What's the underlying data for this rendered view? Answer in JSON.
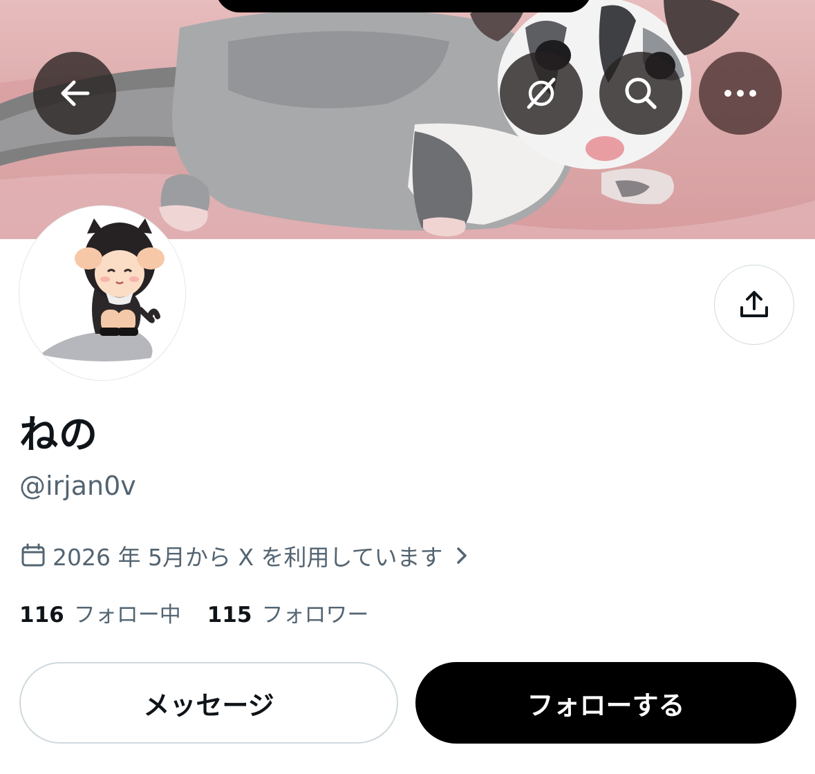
{
  "header": {
    "back_icon": "arrow-left-icon",
    "grok_icon": "grok-icon",
    "search_icon": "search-icon",
    "more_icon": "more-horizontal-icon",
    "banner_description": "sugar glider on pink blanket"
  },
  "profile": {
    "display_name": "ねの",
    "handle": "@irjan0v",
    "joined_text": "2026 年 5月から X を利用しています",
    "following_count": "116",
    "following_label": "フォロー中",
    "followers_count": "115",
    "followers_label": "フォロワー"
  },
  "actions": {
    "message_label": "メッセージ",
    "follow_label": "フォローする",
    "share_icon": "share-icon"
  },
  "colors": {
    "text_primary": "#0f1419",
    "text_secondary": "#536471",
    "border": "#cfd9de",
    "follow_bg": "#000000",
    "banner_pink": "#dba8a9"
  }
}
